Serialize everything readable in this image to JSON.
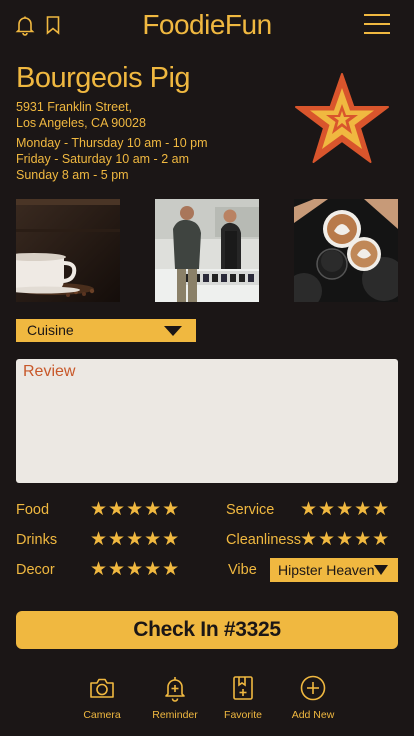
{
  "app": {
    "title": "FoodieFun"
  },
  "restaurant": {
    "name": "Bourgeois Pig",
    "address_line1": "5931 Franklin Street,",
    "address_line2": "Los Angeles, CA 90028",
    "hours": [
      "Monday - Thursday  10 am - 10 pm",
      "Friday - Saturday  10 am - 2 am",
      "Sunday 8 am - 5 pm"
    ]
  },
  "photos": [
    {
      "icon": "coffee-cup-photo"
    },
    {
      "icon": "baristas-counter-photo"
    },
    {
      "icon": "latte-cups-photo"
    }
  ],
  "cuisine": {
    "label": "Cuisine"
  },
  "review": {
    "label": "Review"
  },
  "ratings": {
    "food": {
      "label": "Food",
      "stars": "★★★★★",
      "value": 5
    },
    "drinks": {
      "label": "Drinks",
      "stars": "★★★★★",
      "value": 5
    },
    "decor": {
      "label": "Decor",
      "stars": "★★★★★",
      "value": 5
    },
    "service": {
      "label": "Service",
      "stars": "★★★★★",
      "value": 5
    },
    "cleanliness": {
      "label": "Cleanliness",
      "stars": "★★★★★",
      "value": 5
    },
    "vibe": {
      "label": "Vibe",
      "selected": "Hipster Heaven"
    }
  },
  "checkin": {
    "label": "Check In #3325"
  },
  "nav": [
    {
      "label": "Camera",
      "icon": "camera-icon"
    },
    {
      "label": "Reminder",
      "icon": "reminder-bell-icon"
    },
    {
      "label": "Favorite",
      "icon": "favorite-bookmark-icon"
    },
    {
      "label": "Add New",
      "icon": "add-circle-icon"
    }
  ],
  "colors": {
    "background": "#1b1616",
    "accent": "#f0b840",
    "review_label": "#c8582a",
    "review_bg": "#ece8e3",
    "star_logo_red": "#d9552c"
  }
}
